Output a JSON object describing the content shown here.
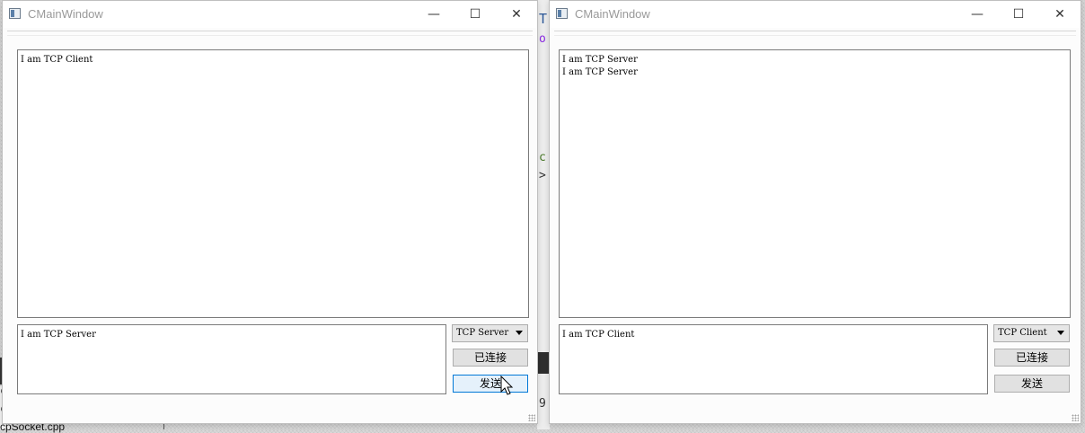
{
  "background": {
    "left_text": "cpSocket.cpp",
    "left_chars": [
      "c",
      "c"
    ],
    "mid_chars": [
      "T",
      "o",
      "c",
      ">",
      "9"
    ]
  },
  "client_window": {
    "title": "CMainWindow",
    "controls": {
      "minimize": "—",
      "maximize": "☐",
      "close": "✕"
    },
    "log_lines": [
      "I am TCP Client"
    ],
    "input_text": "I am TCP Server",
    "mode_select": "TCP Server",
    "status_button": "已连接",
    "send_button": "发送"
  },
  "server_window": {
    "title": "CMainWindow",
    "controls": {
      "minimize": "—",
      "maximize": "☐",
      "close": "✕"
    },
    "log_lines": [
      "I am TCP Server",
      "I am TCP Server"
    ],
    "input_text": "I am TCP Client",
    "mode_select": "TCP Client",
    "status_button": "已连接",
    "send_button": "发送"
  }
}
